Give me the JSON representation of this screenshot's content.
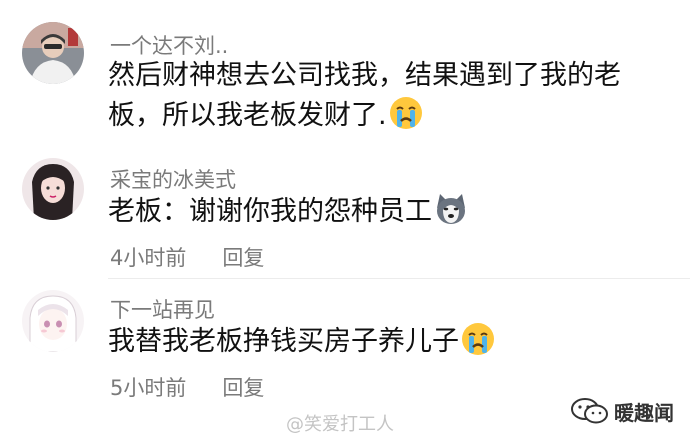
{
  "comments": [
    {
      "username": "一个达不刘..",
      "text": "然后财神想去公司找我，结果遇到了我的老板，所以我老板发财了.",
      "emoji": "crying-face"
    },
    {
      "username": "采宝的冰美式",
      "text": "老板：谢谢你我的怨种员工",
      "emoji": "husky-dog-face",
      "time": "4小时前",
      "reply": "回复"
    },
    {
      "username": "下一站再见",
      "text": "我替我老板挣钱买房子养儿子",
      "emoji": "crying-face",
      "time": "5小时前",
      "reply": "回复"
    }
  ],
  "watermark": {
    "text": "暖趣闻",
    "weibo": "@笑爱打工人"
  }
}
